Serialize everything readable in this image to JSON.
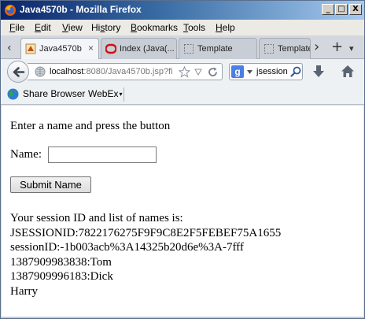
{
  "window": {
    "title": "Java4570b - Mozilla Firefox",
    "controls": {
      "minimize": "_",
      "maximize": "□",
      "close": "X"
    }
  },
  "menubar": {
    "items": [
      {
        "accel": "F",
        "rest": "ile"
      },
      {
        "accel": "E",
        "rest": "dit"
      },
      {
        "accel": "V",
        "rest": "iew"
      },
      {
        "prefix": "Hi",
        "accel": "s",
        "rest": "tory"
      },
      {
        "accel": "B",
        "rest": "ookmarks"
      },
      {
        "accel": "T",
        "rest": "ools"
      },
      {
        "accel": "H",
        "rest": "elp"
      }
    ]
  },
  "tabs": [
    {
      "label": "Java4570b",
      "active": true,
      "close": "×"
    },
    {
      "label": "Index (Java(...",
      "active": false
    },
    {
      "label": "Template",
      "active": false
    },
    {
      "label": "Template",
      "active": false
    }
  ],
  "tabstrip": {
    "scroll_left": "‹",
    "scroll_right": "›",
    "new_tab": "+",
    "list": "▾"
  },
  "navbar": {
    "url_host": "localhost",
    "url_rest": ":8080/Java4570b.jsp?fi",
    "search_engine_glyph": "g",
    "search_text": "jsession"
  },
  "bookmarks": {
    "share": "Share Browser",
    "webex": "WebEx"
  },
  "page": {
    "prompt": "Enter a name and press the button",
    "name_label": "Name:",
    "name_value": "",
    "submit_label": "Submit Name",
    "output_heading": "Your session ID and list of names is:",
    "output_lines": [
      "JSESSIONID:7822176275F9F9C8E2F5FEBEF75A1655",
      "sessionID:-1b003acb%3A14325b20d6e%3A-7fff",
      "1387909983838:Tom",
      "1387909996183:Dick",
      "Harry"
    ]
  }
}
